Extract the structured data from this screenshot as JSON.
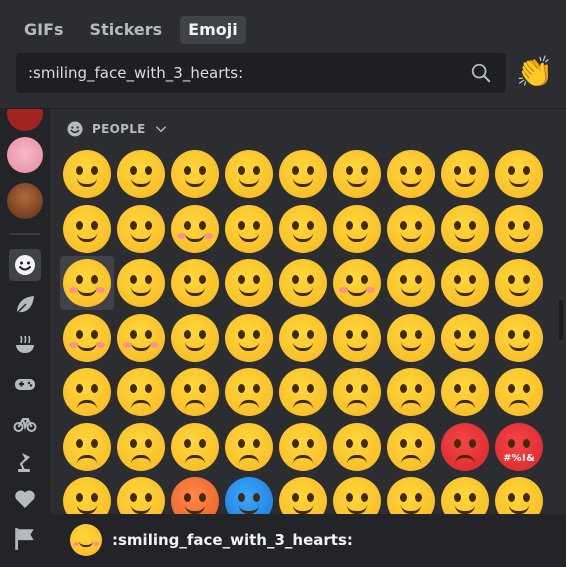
{
  "tabs": [
    {
      "label": "GIFs",
      "active": false
    },
    {
      "label": "Stickers",
      "active": false
    },
    {
      "label": "Emoji",
      "active": true
    }
  ],
  "search": {
    "value": "",
    "placeholder": ":smiling_face_with_3_hearts:"
  },
  "random_emoji_button": {
    "glyph": "👏",
    "icon": "clapping-hands-icon"
  },
  "rail": {
    "categories": [
      {
        "name": "people",
        "icon": "smile-icon",
        "active": true
      },
      {
        "name": "nature",
        "icon": "leaf-icon",
        "active": false
      },
      {
        "name": "food",
        "icon": "bowl-icon",
        "active": false
      },
      {
        "name": "activities",
        "icon": "gamepad-icon",
        "active": false
      },
      {
        "name": "travel",
        "icon": "bicycle-icon",
        "active": false
      },
      {
        "name": "objects",
        "icon": "lamp-icon",
        "active": false
      },
      {
        "name": "symbols",
        "icon": "heart-icon",
        "active": false
      },
      {
        "name": "flags",
        "icon": "flag-icon",
        "active": false
      }
    ]
  },
  "section": {
    "label": "PEOPLE",
    "icon": "smile-icon"
  },
  "emoji_grid": {
    "selected_index": 18,
    "special_tiles": {
      "red_angry_label": "#%!&"
    }
  },
  "footer": {
    "preview_name": ":smiling_face_with_3_hearts:"
  },
  "colors": {
    "background": "#2b2d31",
    "rail": "#232428",
    "input": "#1e1f22",
    "active_tab": "#404249",
    "emoji_yellow": "#f9c02a"
  }
}
